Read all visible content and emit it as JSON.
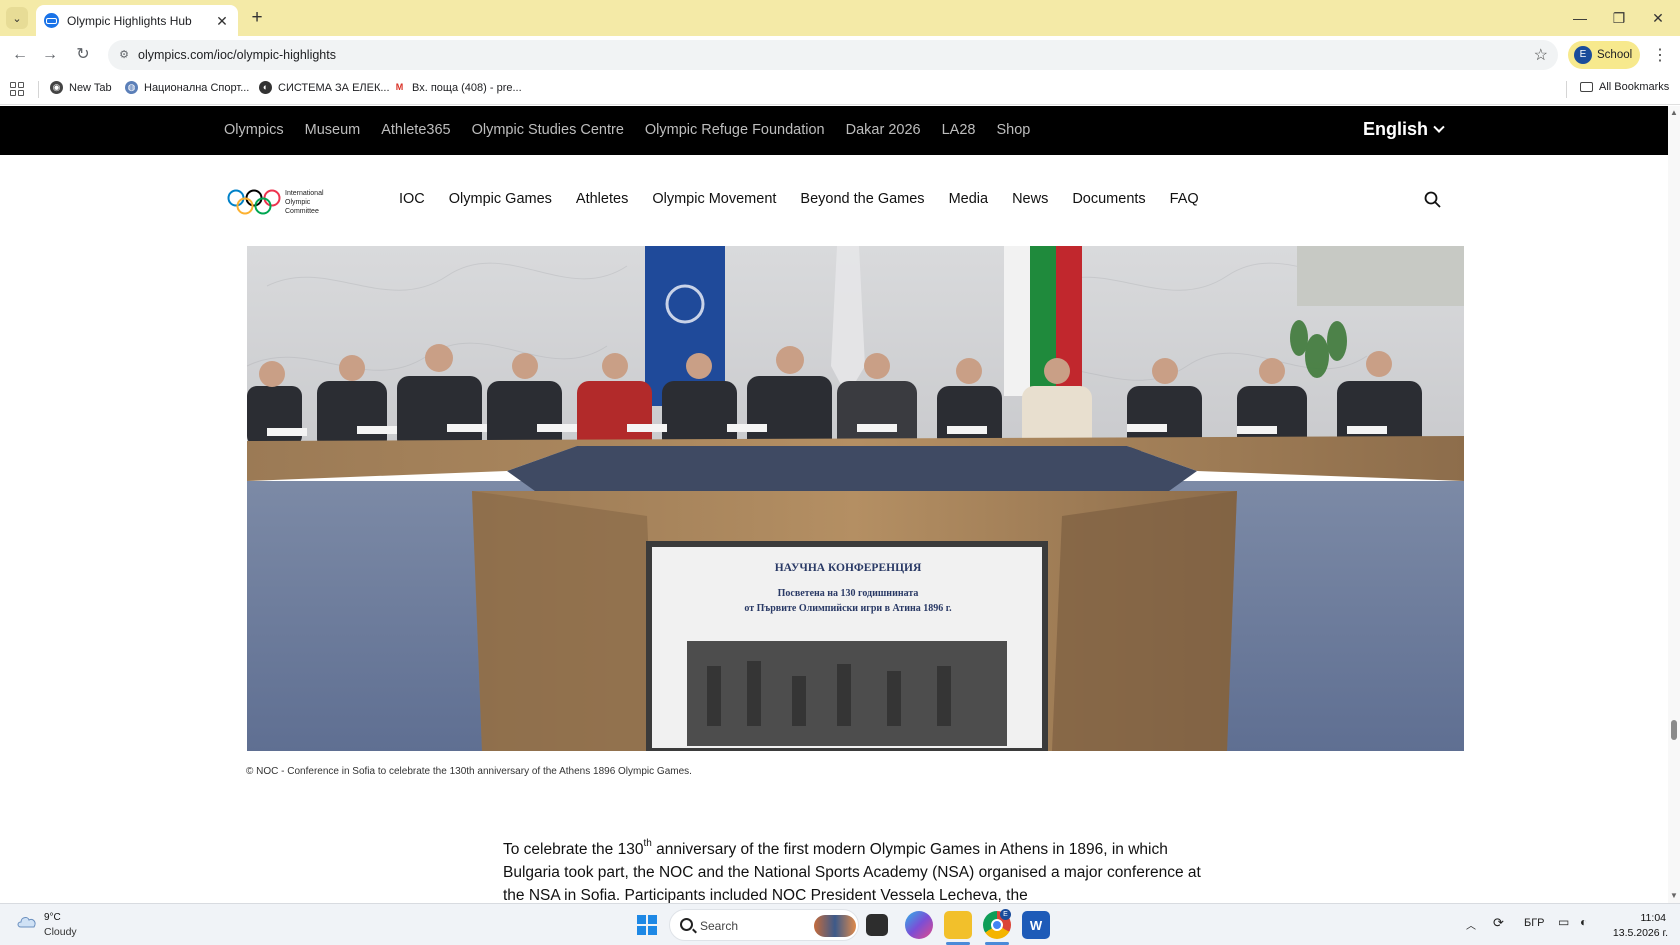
{
  "browser": {
    "tab_title": "Olympic Highlights Hub",
    "url": "olympics.com/ioc/olympic-highlights",
    "profile_initial": "E",
    "profile_label": "School",
    "bookmarks": [
      {
        "label": "New Tab",
        "icon": "new-tab-icon"
      },
      {
        "label": "Национална Спорт...",
        "icon": "globe-icon"
      },
      {
        "label": "СИСТЕМА ЗА ЕЛЕК...",
        "icon": "site-icon"
      },
      {
        "label": "Вх. поща (408) - pre...",
        "icon": "gmail-icon"
      }
    ],
    "all_bookmarks": "All Bookmarks"
  },
  "topbar": {
    "links": [
      "Olympics",
      "Museum",
      "Athlete365",
      "Olympic Studies Centre",
      "Olympic Refuge Foundation",
      "Dakar 2026",
      "LA28",
      "Shop"
    ],
    "language": "English"
  },
  "logo": {
    "line1": "International",
    "line2": "Olympic",
    "line3": "Committee"
  },
  "nav": {
    "items": [
      "IOC",
      "Olympic Games",
      "Athletes",
      "Olympic Movement",
      "Beyond the Games",
      "Media",
      "News",
      "Documents",
      "FAQ"
    ]
  },
  "hero": {
    "screen_title": "НАУЧНА КОНФЕРЕНЦИЯ",
    "screen_line1": "Посветена на 130 годишнината",
    "screen_line2": "от Първите Олимпийски игри в Атина 1896 г.",
    "caption": "© NOC - Conference in Sofia to celebrate the 130th anniversary of the Athens 1896 Olympic Games."
  },
  "article": {
    "p1_a": "To celebrate the 130",
    "p1_sup": "th",
    "p1_b": " anniversary of the first modern Olympic Games in Athens in 1896, in which Bulgaria took part, the NOC and the National Sports Academy (NSA) organised a major conference at the NSA in Sofia. Participants included NOC President Vessela Lecheva, the"
  },
  "taskbar": {
    "temp": "9°C",
    "condition": "Cloudy",
    "search_placeholder": "Search",
    "lang": "БГР",
    "time": "11:04",
    "date": "13.5.2026 г.",
    "chrome_badge": "E"
  },
  "colors": {
    "tabstrip": "#f4eaa7",
    "topbar": "#000000",
    "accent": "#1a73e8"
  }
}
